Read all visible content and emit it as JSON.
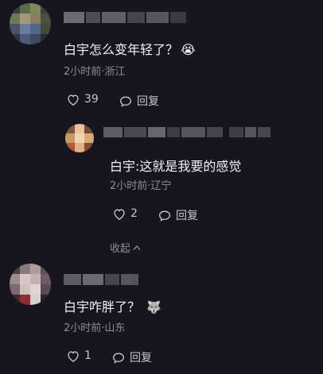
{
  "comments": [
    {
      "text": "白宇怎么变年轻了？",
      "emoji": "😭",
      "meta": "2小时前·浙江",
      "likes": "39",
      "reply_label": "回复"
    },
    {
      "text": "白宇:这就是我要的感觉",
      "meta": "2小时前·辽宁",
      "likes": "2",
      "reply_label": "回复",
      "collapse_label": "收起"
    },
    {
      "text": "白宇咋胖了？",
      "emoji": "🐺",
      "meta": "2小时前·山东",
      "likes": "1",
      "reply_label": "回复"
    }
  ],
  "icons": {
    "like": "heart-outline-icon",
    "reply": "speech-bubble-icon",
    "collapse": "chevron-up-icon"
  },
  "colors": {
    "background": "#17161f",
    "text": "#f1f1f5",
    "meta": "#8d8c97"
  }
}
